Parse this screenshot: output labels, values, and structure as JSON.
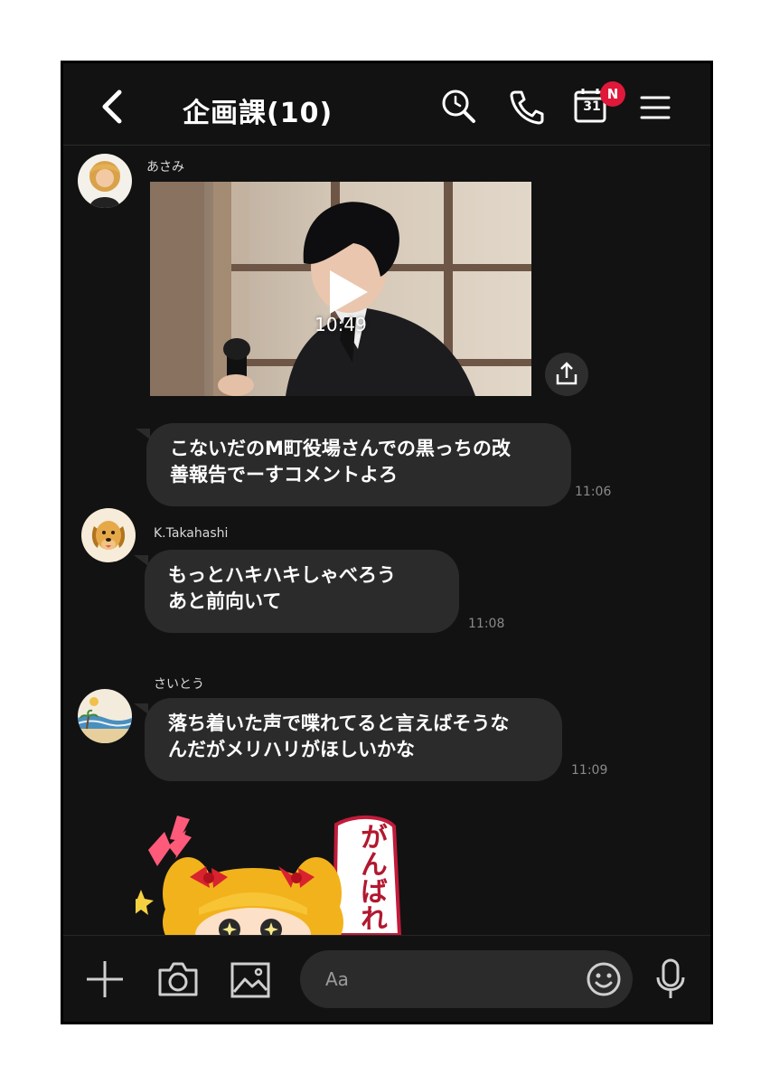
{
  "header": {
    "title": "企画課(10)",
    "calendar_day": "31",
    "badge": "N"
  },
  "messages": [
    {
      "sender": "あさみ",
      "type": "video",
      "duration": "10:49"
    },
    {
      "sender": "あさみ",
      "type": "text",
      "lines": [
        "こないだのM町役場さんでの黒っちの改",
        "善報告でーすコメントよろ"
      ],
      "time": "11:06"
    },
    {
      "sender": "K.Takahashi",
      "type": "text",
      "lines": [
        "もっとハキハキしゃべろう",
        "あと前向いて"
      ],
      "time": "11:08"
    },
    {
      "sender": "さいとう",
      "type": "text",
      "lines": [
        "落ち着いた声で喋れてると言えばそうな",
        "んだがメリハリがほしいかな"
      ],
      "time": "11:09"
    },
    {
      "type": "sticker",
      "text": "がんばれ"
    }
  ],
  "composer": {
    "placeholder": "Aa"
  },
  "colors": {
    "background": "#121212",
    "bubble": "#2b2b2b",
    "badge": "#e0183a"
  }
}
